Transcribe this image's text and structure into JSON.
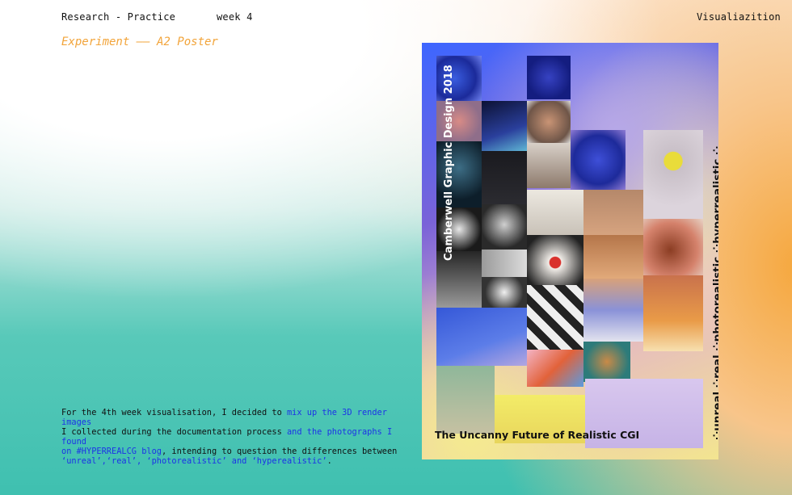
{
  "header": {
    "left": "Research - Practice",
    "week": "week 4",
    "right": "Visualiazition"
  },
  "subtitle": "Experiment —— A2 Poster",
  "body": {
    "line1_plain": "For the 4th week visualisation, I decided to ",
    "line1_link": "mix up the 3D render images",
    "line2_plain": "I collected during the documentation process ",
    "line2_link": "and the photographs I found",
    "line3_link": "on #HYPERREALCG blog",
    "line3_plain": ", intending to question the differences between",
    "line4_link1": "‘unreal’,‘real’, ‘photorealistic’ and ‘hyperealistic’",
    "line4_plain": "."
  },
  "poster": {
    "vertical_title": "Camberwell Graphic Design 2018",
    "vertical_terms": "⁘unreal ⁘real ⁘photorealistic ⁘hyperrealistic ⁘",
    "bottom_title": "The Uncanny Future of Realistic CGI"
  },
  "colors": {
    "accent_orange": "#f2a43a",
    "link_blue": "#1d33e6"
  }
}
